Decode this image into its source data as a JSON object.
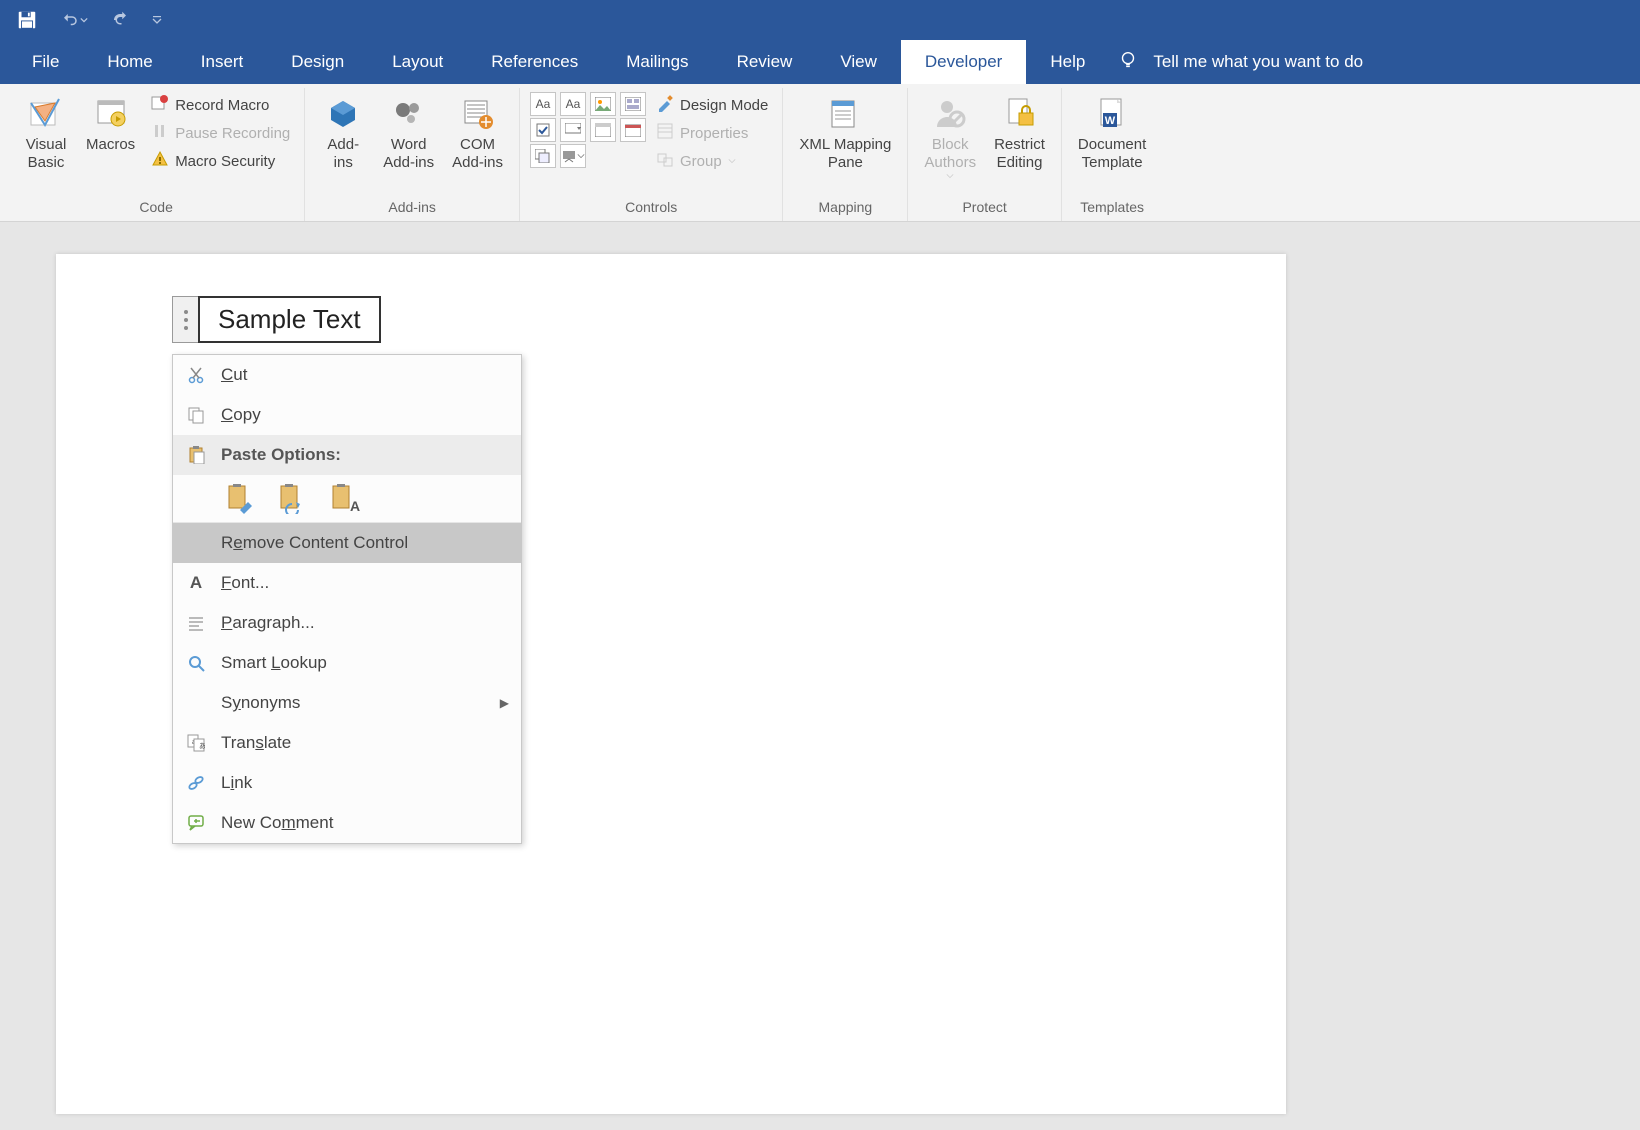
{
  "qat": {
    "save": "Save",
    "undo": "Undo",
    "redo": "Redo",
    "customize": "Customize"
  },
  "tabs": [
    "File",
    "Home",
    "Insert",
    "Design",
    "Layout",
    "References",
    "Mailings",
    "Review",
    "View",
    "Developer",
    "Help"
  ],
  "active_tab_index": 9,
  "tell_me": "Tell me what you want to do",
  "ribbon": {
    "code": {
      "label": "Code",
      "visual_basic": "Visual\nBasic",
      "macros": "Macros",
      "record_macro": "Record Macro",
      "pause_recording": "Pause Recording",
      "macro_security": "Macro Security"
    },
    "addins": {
      "label": "Add-ins",
      "addins": "Add-\nins",
      "word_addins": "Word\nAdd-ins",
      "com_addins": "COM\nAdd-ins"
    },
    "controls": {
      "label": "Controls",
      "design_mode": "Design Mode",
      "properties": "Properties",
      "group": "Group"
    },
    "mapping": {
      "label": "Mapping",
      "xml_mapping": "XML Mapping\nPane"
    },
    "protect": {
      "label": "Protect",
      "block_authors": "Block\nAuthors",
      "restrict": "Restrict\nEditing"
    },
    "templates": {
      "label": "Templates",
      "doc_template": "Document\nTemplate"
    }
  },
  "content_control_text": "Sample Text",
  "context_menu": {
    "cut": "Cut",
    "copy": "Copy",
    "paste_options": "Paste Options:",
    "remove_cc": "Remove Content Control",
    "font": "Font...",
    "paragraph": "Paragraph...",
    "smart_lookup": "Smart Lookup",
    "synonyms": "Synonyms",
    "translate": "Translate",
    "link": "Link",
    "new_comment": "New Comment"
  }
}
